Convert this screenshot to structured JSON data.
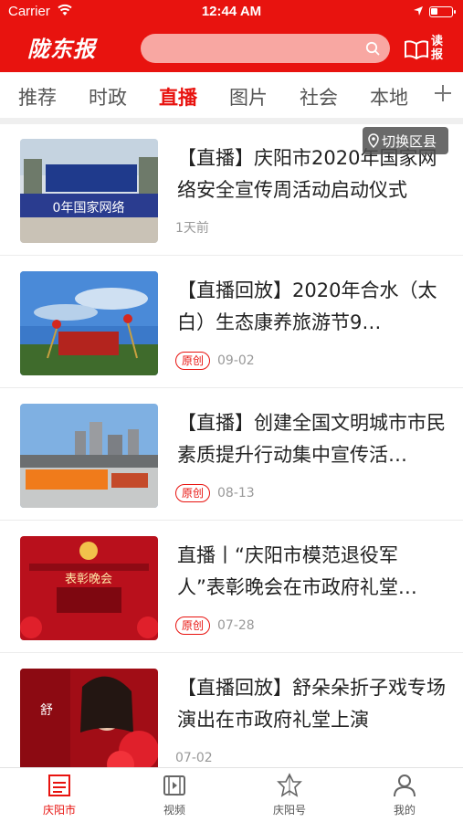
{
  "status_bar": {
    "carrier": "Carrier",
    "time": "12:44 AM"
  },
  "header": {
    "logo": "陇东报",
    "search_placeholder": "",
    "read_label": "读报"
  },
  "tabs": [
    {
      "label": "推荐",
      "active": false
    },
    {
      "label": "时政",
      "active": false
    },
    {
      "label": "直播",
      "active": true
    },
    {
      "label": "图片",
      "active": false
    },
    {
      "label": "社会",
      "active": false
    },
    {
      "label": "本地",
      "active": false
    }
  ],
  "region_switch": {
    "label": "切换区县"
  },
  "news": [
    {
      "title": "【直播】庆阳市2020年国家网络安全宣传周活动启动仪式",
      "badge": "",
      "date": "1天前",
      "thumb_overlay": "0年国家网络"
    },
    {
      "title": "【直播回放】2020年合水（太白）生态康养旅游节9…",
      "badge": "原创",
      "date": "09-02",
      "thumb_overlay": ""
    },
    {
      "title": "【直播】创建全国文明城市市民素质提升行动集中宣传活…",
      "badge": "原创",
      "date": "08-13",
      "thumb_overlay": ""
    },
    {
      "title": "直播丨“庆阳市模范退役军人”表彰晚会在市政府礼堂…",
      "badge": "原创",
      "date": "07-28",
      "thumb_overlay": "表彰晚会"
    },
    {
      "title": "【直播回放】舒朵朵折子戏专场演出在市政府礼堂上演",
      "badge": "",
      "date": "07-02",
      "thumb_overlay": ""
    }
  ],
  "bottom_nav": [
    {
      "label": "庆阳市",
      "icon": "news-icon",
      "active": true
    },
    {
      "label": "视频",
      "icon": "video-icon",
      "active": false
    },
    {
      "label": "庆阳号",
      "icon": "star-icon",
      "active": false
    },
    {
      "label": "我的",
      "icon": "user-icon",
      "active": false
    }
  ],
  "colors": {
    "brand_red": "#e8130f",
    "search_bg": "#f8a7a2"
  }
}
